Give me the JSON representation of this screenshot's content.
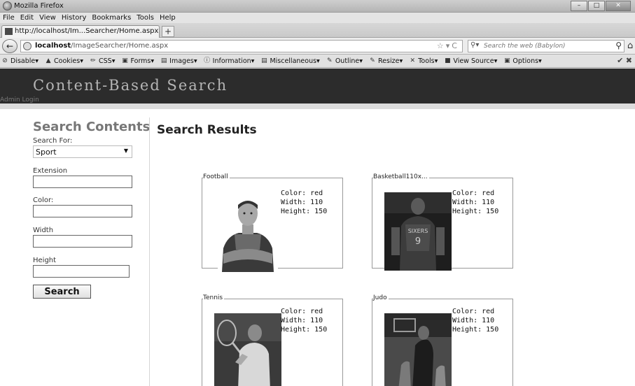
{
  "window": {
    "title": "Mozilla Firefox"
  },
  "menu": [
    "File",
    "Edit",
    "View",
    "History",
    "Bookmarks",
    "Tools",
    "Help"
  ],
  "tab": {
    "label": "http://localhost/Im...Searcher/Home.aspx",
    "new_tab": "+"
  },
  "nav": {
    "url_host": "localhost",
    "url_path": "/ImageSearcher/Home.aspx",
    "search_placeholder": "Search the web (Babylon)"
  },
  "devbar": [
    "Disable",
    "Cookies",
    "CSS",
    "Forms",
    "Images",
    "Information",
    "Miscellaneous",
    "Outline",
    "Resize",
    "Tools",
    "View Source",
    "Options"
  ],
  "site": {
    "title": "Content-Based Search",
    "admin_link": "Admin Login"
  },
  "sidebar": {
    "title": "Search Contents",
    "search_for_label": "Search For:",
    "search_for_value": "Sport",
    "extension_label": "Extension",
    "color_label": "Color:",
    "width_label": "Width",
    "height_label": "Height",
    "search_button": "Search"
  },
  "results": {
    "title": "Search Results",
    "items": [
      {
        "name": "Football",
        "color": "Color: red",
        "width": "Width: 110",
        "height": "Height: 150"
      },
      {
        "name": "Basketball110x...",
        "color": "Color: red",
        "width": "Width: 110",
        "height": "Height: 150"
      },
      {
        "name": "Tennis",
        "color": "Color: red",
        "width": "Width: 110",
        "height": "Height: 150"
      },
      {
        "name": "Judo",
        "color": "Color: red",
        "width": "Width: 110",
        "height": "Height: 150"
      }
    ]
  }
}
